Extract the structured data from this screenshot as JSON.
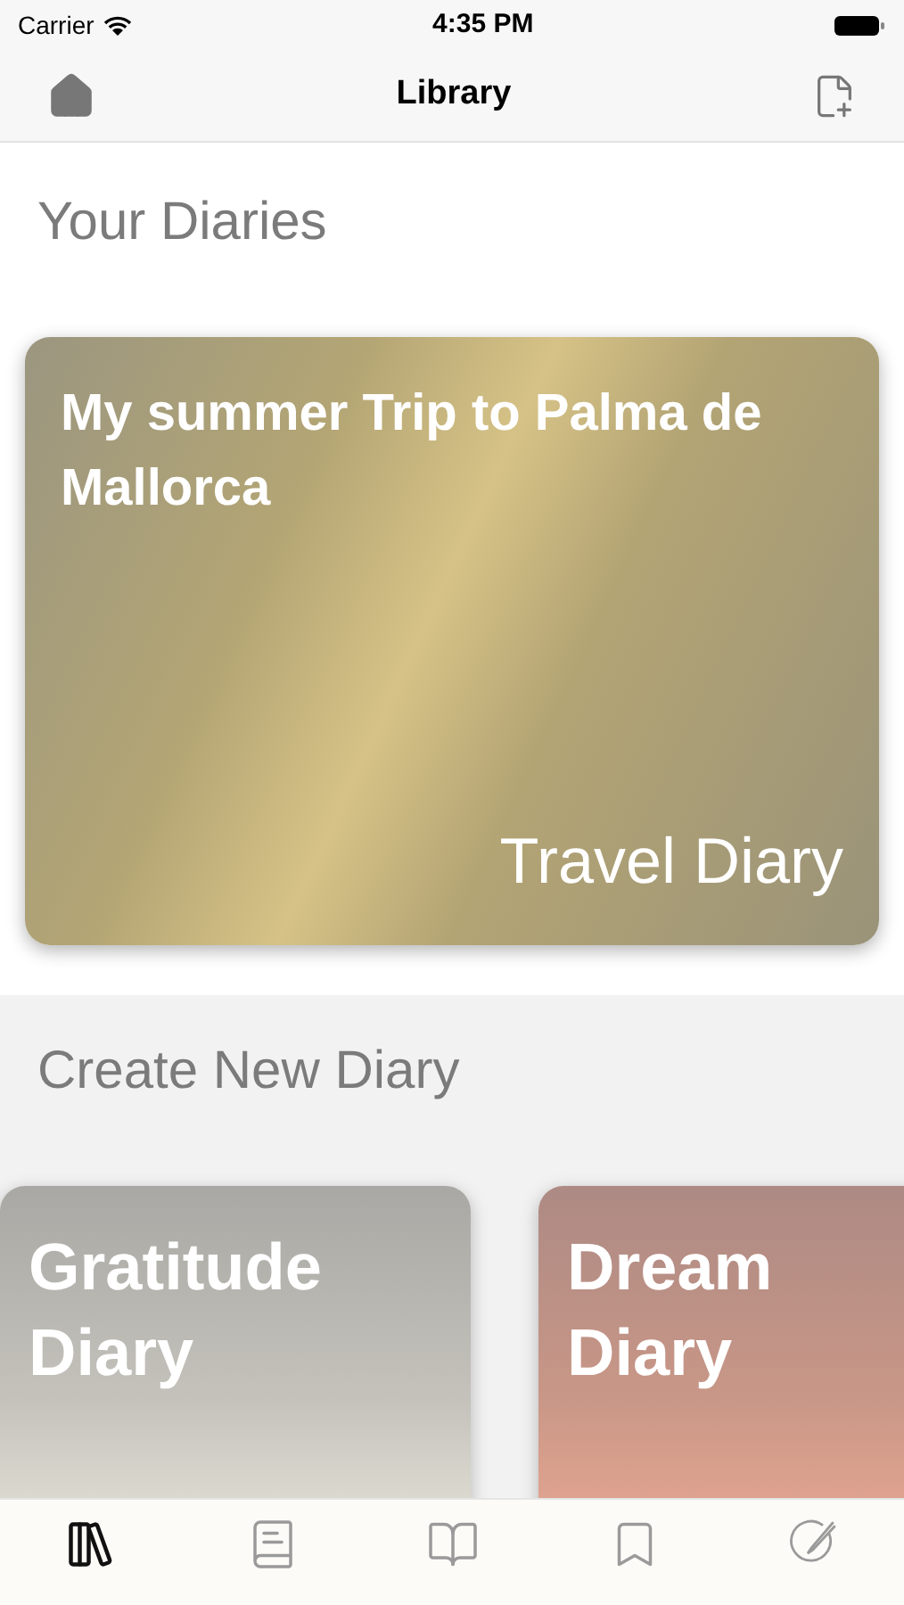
{
  "status_bar": {
    "carrier": "Carrier",
    "time": "4:35 PM"
  },
  "nav": {
    "title": "Library"
  },
  "your_diaries": {
    "heading": "Your Diaries",
    "diaries": [
      {
        "title": "My summer Trip to Palma de Mallorca",
        "type": "Travel Diary"
      }
    ]
  },
  "create_new": {
    "heading": "Create New Diary",
    "templates": [
      {
        "title": "Gratitude Diary",
        "kind": "gratitude"
      },
      {
        "title": "Dream Diary",
        "kind": "dream"
      }
    ]
  },
  "tab_bar": [
    {
      "kind": "library",
      "selected": true
    },
    {
      "kind": "book",
      "selected": false
    },
    {
      "kind": "open-book",
      "selected": false
    },
    {
      "kind": "bookmark",
      "selected": false
    },
    {
      "kind": "pen-circle",
      "selected": false
    }
  ]
}
